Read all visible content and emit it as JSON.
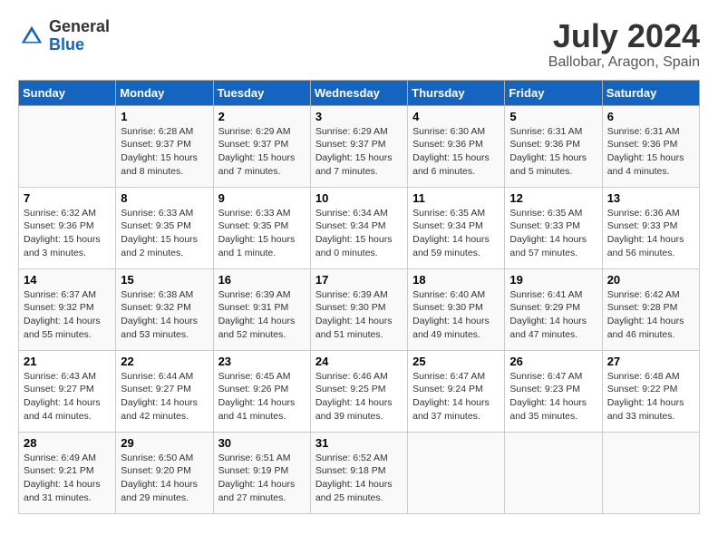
{
  "logo": {
    "general": "General",
    "blue": "Blue"
  },
  "title": "July 2024",
  "location": "Ballobar, Aragon, Spain",
  "days": [
    "Sunday",
    "Monday",
    "Tuesday",
    "Wednesday",
    "Thursday",
    "Friday",
    "Saturday"
  ],
  "weeks": [
    [
      {
        "date": "",
        "info": ""
      },
      {
        "date": "1",
        "info": "Sunrise: 6:28 AM\nSunset: 9:37 PM\nDaylight: 15 hours\nand 8 minutes."
      },
      {
        "date": "2",
        "info": "Sunrise: 6:29 AM\nSunset: 9:37 PM\nDaylight: 15 hours\nand 7 minutes."
      },
      {
        "date": "3",
        "info": "Sunrise: 6:29 AM\nSunset: 9:37 PM\nDaylight: 15 hours\nand 7 minutes."
      },
      {
        "date": "4",
        "info": "Sunrise: 6:30 AM\nSunset: 9:36 PM\nDaylight: 15 hours\nand 6 minutes."
      },
      {
        "date": "5",
        "info": "Sunrise: 6:31 AM\nSunset: 9:36 PM\nDaylight: 15 hours\nand 5 minutes."
      },
      {
        "date": "6",
        "info": "Sunrise: 6:31 AM\nSunset: 9:36 PM\nDaylight: 15 hours\nand 4 minutes."
      }
    ],
    [
      {
        "date": "7",
        "info": "Sunrise: 6:32 AM\nSunset: 9:36 PM\nDaylight: 15 hours\nand 3 minutes."
      },
      {
        "date": "8",
        "info": "Sunrise: 6:33 AM\nSunset: 9:35 PM\nDaylight: 15 hours\nand 2 minutes."
      },
      {
        "date": "9",
        "info": "Sunrise: 6:33 AM\nSunset: 9:35 PM\nDaylight: 15 hours\nand 1 minute."
      },
      {
        "date": "10",
        "info": "Sunrise: 6:34 AM\nSunset: 9:34 PM\nDaylight: 15 hours\nand 0 minutes."
      },
      {
        "date": "11",
        "info": "Sunrise: 6:35 AM\nSunset: 9:34 PM\nDaylight: 14 hours\nand 59 minutes."
      },
      {
        "date": "12",
        "info": "Sunrise: 6:35 AM\nSunset: 9:33 PM\nDaylight: 14 hours\nand 57 minutes."
      },
      {
        "date": "13",
        "info": "Sunrise: 6:36 AM\nSunset: 9:33 PM\nDaylight: 14 hours\nand 56 minutes."
      }
    ],
    [
      {
        "date": "14",
        "info": "Sunrise: 6:37 AM\nSunset: 9:32 PM\nDaylight: 14 hours\nand 55 minutes."
      },
      {
        "date": "15",
        "info": "Sunrise: 6:38 AM\nSunset: 9:32 PM\nDaylight: 14 hours\nand 53 minutes."
      },
      {
        "date": "16",
        "info": "Sunrise: 6:39 AM\nSunset: 9:31 PM\nDaylight: 14 hours\nand 52 minutes."
      },
      {
        "date": "17",
        "info": "Sunrise: 6:39 AM\nSunset: 9:30 PM\nDaylight: 14 hours\nand 51 minutes."
      },
      {
        "date": "18",
        "info": "Sunrise: 6:40 AM\nSunset: 9:30 PM\nDaylight: 14 hours\nand 49 minutes."
      },
      {
        "date": "19",
        "info": "Sunrise: 6:41 AM\nSunset: 9:29 PM\nDaylight: 14 hours\nand 47 minutes."
      },
      {
        "date": "20",
        "info": "Sunrise: 6:42 AM\nSunset: 9:28 PM\nDaylight: 14 hours\nand 46 minutes."
      }
    ],
    [
      {
        "date": "21",
        "info": "Sunrise: 6:43 AM\nSunset: 9:27 PM\nDaylight: 14 hours\nand 44 minutes."
      },
      {
        "date": "22",
        "info": "Sunrise: 6:44 AM\nSunset: 9:27 PM\nDaylight: 14 hours\nand 42 minutes."
      },
      {
        "date": "23",
        "info": "Sunrise: 6:45 AM\nSunset: 9:26 PM\nDaylight: 14 hours\nand 41 minutes."
      },
      {
        "date": "24",
        "info": "Sunrise: 6:46 AM\nSunset: 9:25 PM\nDaylight: 14 hours\nand 39 minutes."
      },
      {
        "date": "25",
        "info": "Sunrise: 6:47 AM\nSunset: 9:24 PM\nDaylight: 14 hours\nand 37 minutes."
      },
      {
        "date": "26",
        "info": "Sunrise: 6:47 AM\nSunset: 9:23 PM\nDaylight: 14 hours\nand 35 minutes."
      },
      {
        "date": "27",
        "info": "Sunrise: 6:48 AM\nSunset: 9:22 PM\nDaylight: 14 hours\nand 33 minutes."
      }
    ],
    [
      {
        "date": "28",
        "info": "Sunrise: 6:49 AM\nSunset: 9:21 PM\nDaylight: 14 hours\nand 31 minutes."
      },
      {
        "date": "29",
        "info": "Sunrise: 6:50 AM\nSunset: 9:20 PM\nDaylight: 14 hours\nand 29 minutes."
      },
      {
        "date": "30",
        "info": "Sunrise: 6:51 AM\nSunset: 9:19 PM\nDaylight: 14 hours\nand 27 minutes."
      },
      {
        "date": "31",
        "info": "Sunrise: 6:52 AM\nSunset: 9:18 PM\nDaylight: 14 hours\nand 25 minutes."
      },
      {
        "date": "",
        "info": ""
      },
      {
        "date": "",
        "info": ""
      },
      {
        "date": "",
        "info": ""
      }
    ]
  ]
}
